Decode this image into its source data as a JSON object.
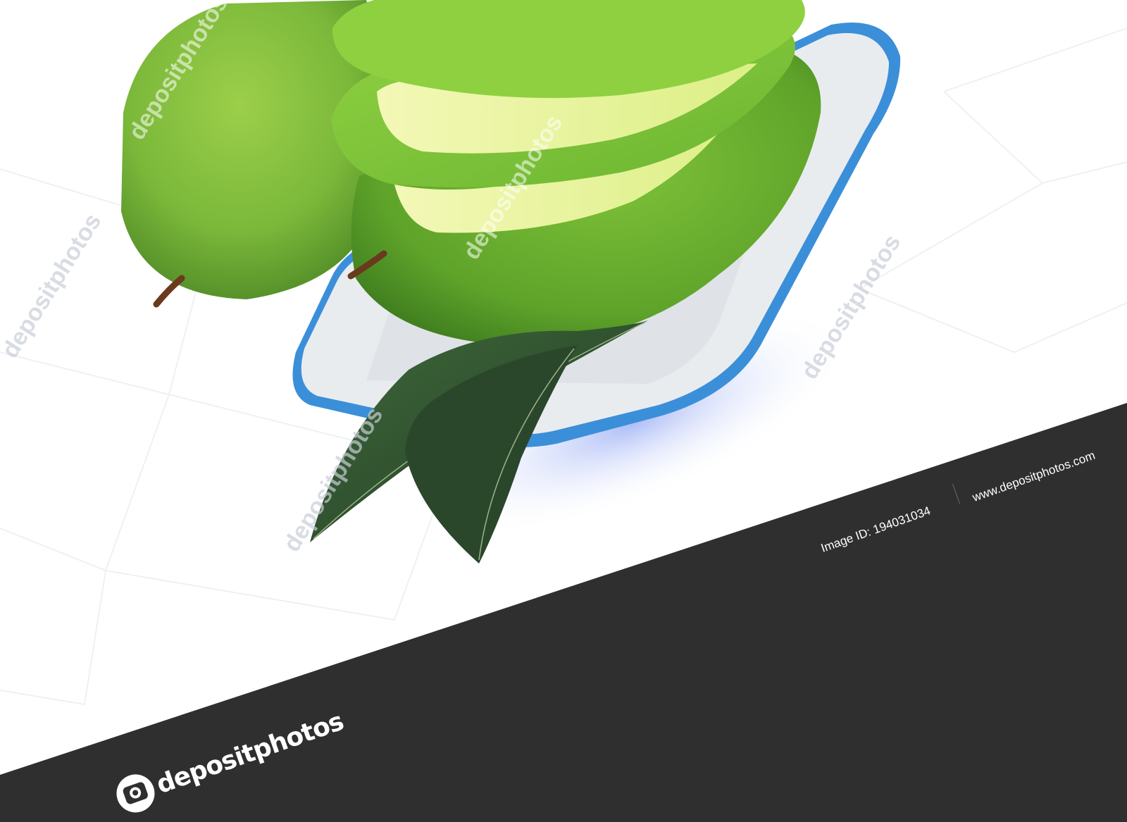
{
  "watermark": {
    "text": "depositphotos"
  },
  "band": {
    "image_id": "Image ID: 194031034",
    "site": "www.depositphotos.com"
  },
  "brand": {
    "name": "depositphotos"
  },
  "colors": {
    "band": "#2f2f2f",
    "mango_green": "#7fc23a",
    "mango_flesh": "#eaf59a",
    "leaf": "#2f4a30",
    "plate": "#e9ecef",
    "plate_rim": "#3b8fd9"
  }
}
